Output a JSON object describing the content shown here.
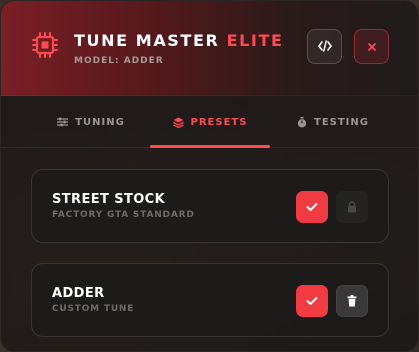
{
  "header": {
    "title_main": "TUNE MASTER",
    "title_accent": "ELITE",
    "model_label": "MODEL: ADDER",
    "icons": {
      "logo": "chip-icon",
      "code": "code-icon",
      "close": "close-icon"
    }
  },
  "tabs": [
    {
      "label": "TUNING",
      "icon": "sliders-icon",
      "active": false
    },
    {
      "label": "PRESETS",
      "icon": "layers-icon",
      "active": true
    },
    {
      "label": "TESTING",
      "icon": "stopwatch-icon",
      "active": false
    }
  ],
  "presets": [
    {
      "name": "STREET STOCK",
      "description": "FACTORY GTA STANDARD",
      "secondary_action": "lock-icon"
    },
    {
      "name": "ADDER",
      "description": "CUSTOM TUNE",
      "secondary_action": "trash-icon"
    }
  ],
  "colors": {
    "accent": "#ff4a4f",
    "check_button": "#ef3b41"
  }
}
